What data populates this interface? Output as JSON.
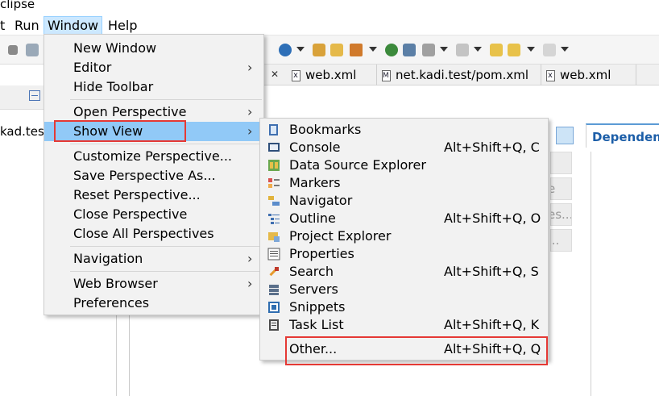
{
  "app": {
    "title_fragment": "clipse"
  },
  "menubar": {
    "items": [
      {
        "label": "t"
      },
      {
        "label": "Run"
      },
      {
        "label": "Window"
      },
      {
        "label": "Help"
      }
    ]
  },
  "left_pane": {
    "project_label": "kad.tes"
  },
  "tabs": [
    {
      "label": "web.xml"
    },
    {
      "label": "net.kadi.test/pom.xml"
    },
    {
      "label": "web.xml"
    }
  ],
  "right_pane": {
    "tab_label": "Dependenc",
    "button_partials": [
      "e",
      "es...",
      "..."
    ]
  },
  "window_menu": {
    "items": [
      {
        "label": "New Window"
      },
      {
        "label": "Editor",
        "submenu": "›"
      },
      {
        "label": "Hide Toolbar"
      },
      {
        "label": "Open Perspective",
        "submenu": "›"
      },
      {
        "label": "Show View",
        "submenu": "›"
      },
      {
        "label": "Customize Perspective..."
      },
      {
        "label": "Save Perspective As..."
      },
      {
        "label": "Reset Perspective..."
      },
      {
        "label": "Close Perspective"
      },
      {
        "label": "Close All Perspectives"
      },
      {
        "label": "Navigation",
        "submenu": "›"
      },
      {
        "label": "Web Browser",
        "submenu": "›"
      },
      {
        "label": "Preferences"
      }
    ]
  },
  "show_view_menu": {
    "items": [
      {
        "label": "Bookmarks",
        "shortcut": "",
        "icon": "bookmarks-icon"
      },
      {
        "label": "Console",
        "shortcut": "Alt+Shift+Q, C",
        "icon": "console-icon"
      },
      {
        "label": "Data Source Explorer",
        "shortcut": "",
        "icon": "data-source-icon"
      },
      {
        "label": "Markers",
        "shortcut": "",
        "icon": "markers-icon"
      },
      {
        "label": "Navigator",
        "shortcut": "",
        "icon": "navigator-icon"
      },
      {
        "label": "Outline",
        "shortcut": "Alt+Shift+Q, O",
        "icon": "outline-icon"
      },
      {
        "label": "Project Explorer",
        "shortcut": "",
        "icon": "project-explorer-icon"
      },
      {
        "label": "Properties",
        "shortcut": "",
        "icon": "properties-icon"
      },
      {
        "label": "Search",
        "shortcut": "Alt+Shift+Q, S",
        "icon": "search-icon"
      },
      {
        "label": "Servers",
        "shortcut": "",
        "icon": "servers-icon"
      },
      {
        "label": "Snippets",
        "shortcut": "",
        "icon": "snippets-icon"
      },
      {
        "label": "Task List",
        "shortcut": "Alt+Shift+Q, K",
        "icon": "task-list-icon"
      },
      {
        "label": "Other...",
        "shortcut": "Alt+Shift+Q, Q",
        "icon": ""
      }
    ]
  },
  "colors": {
    "highlight": "#91c9f7",
    "annotation_box": "#e53935",
    "menu_bg": "#f2f2f2"
  }
}
